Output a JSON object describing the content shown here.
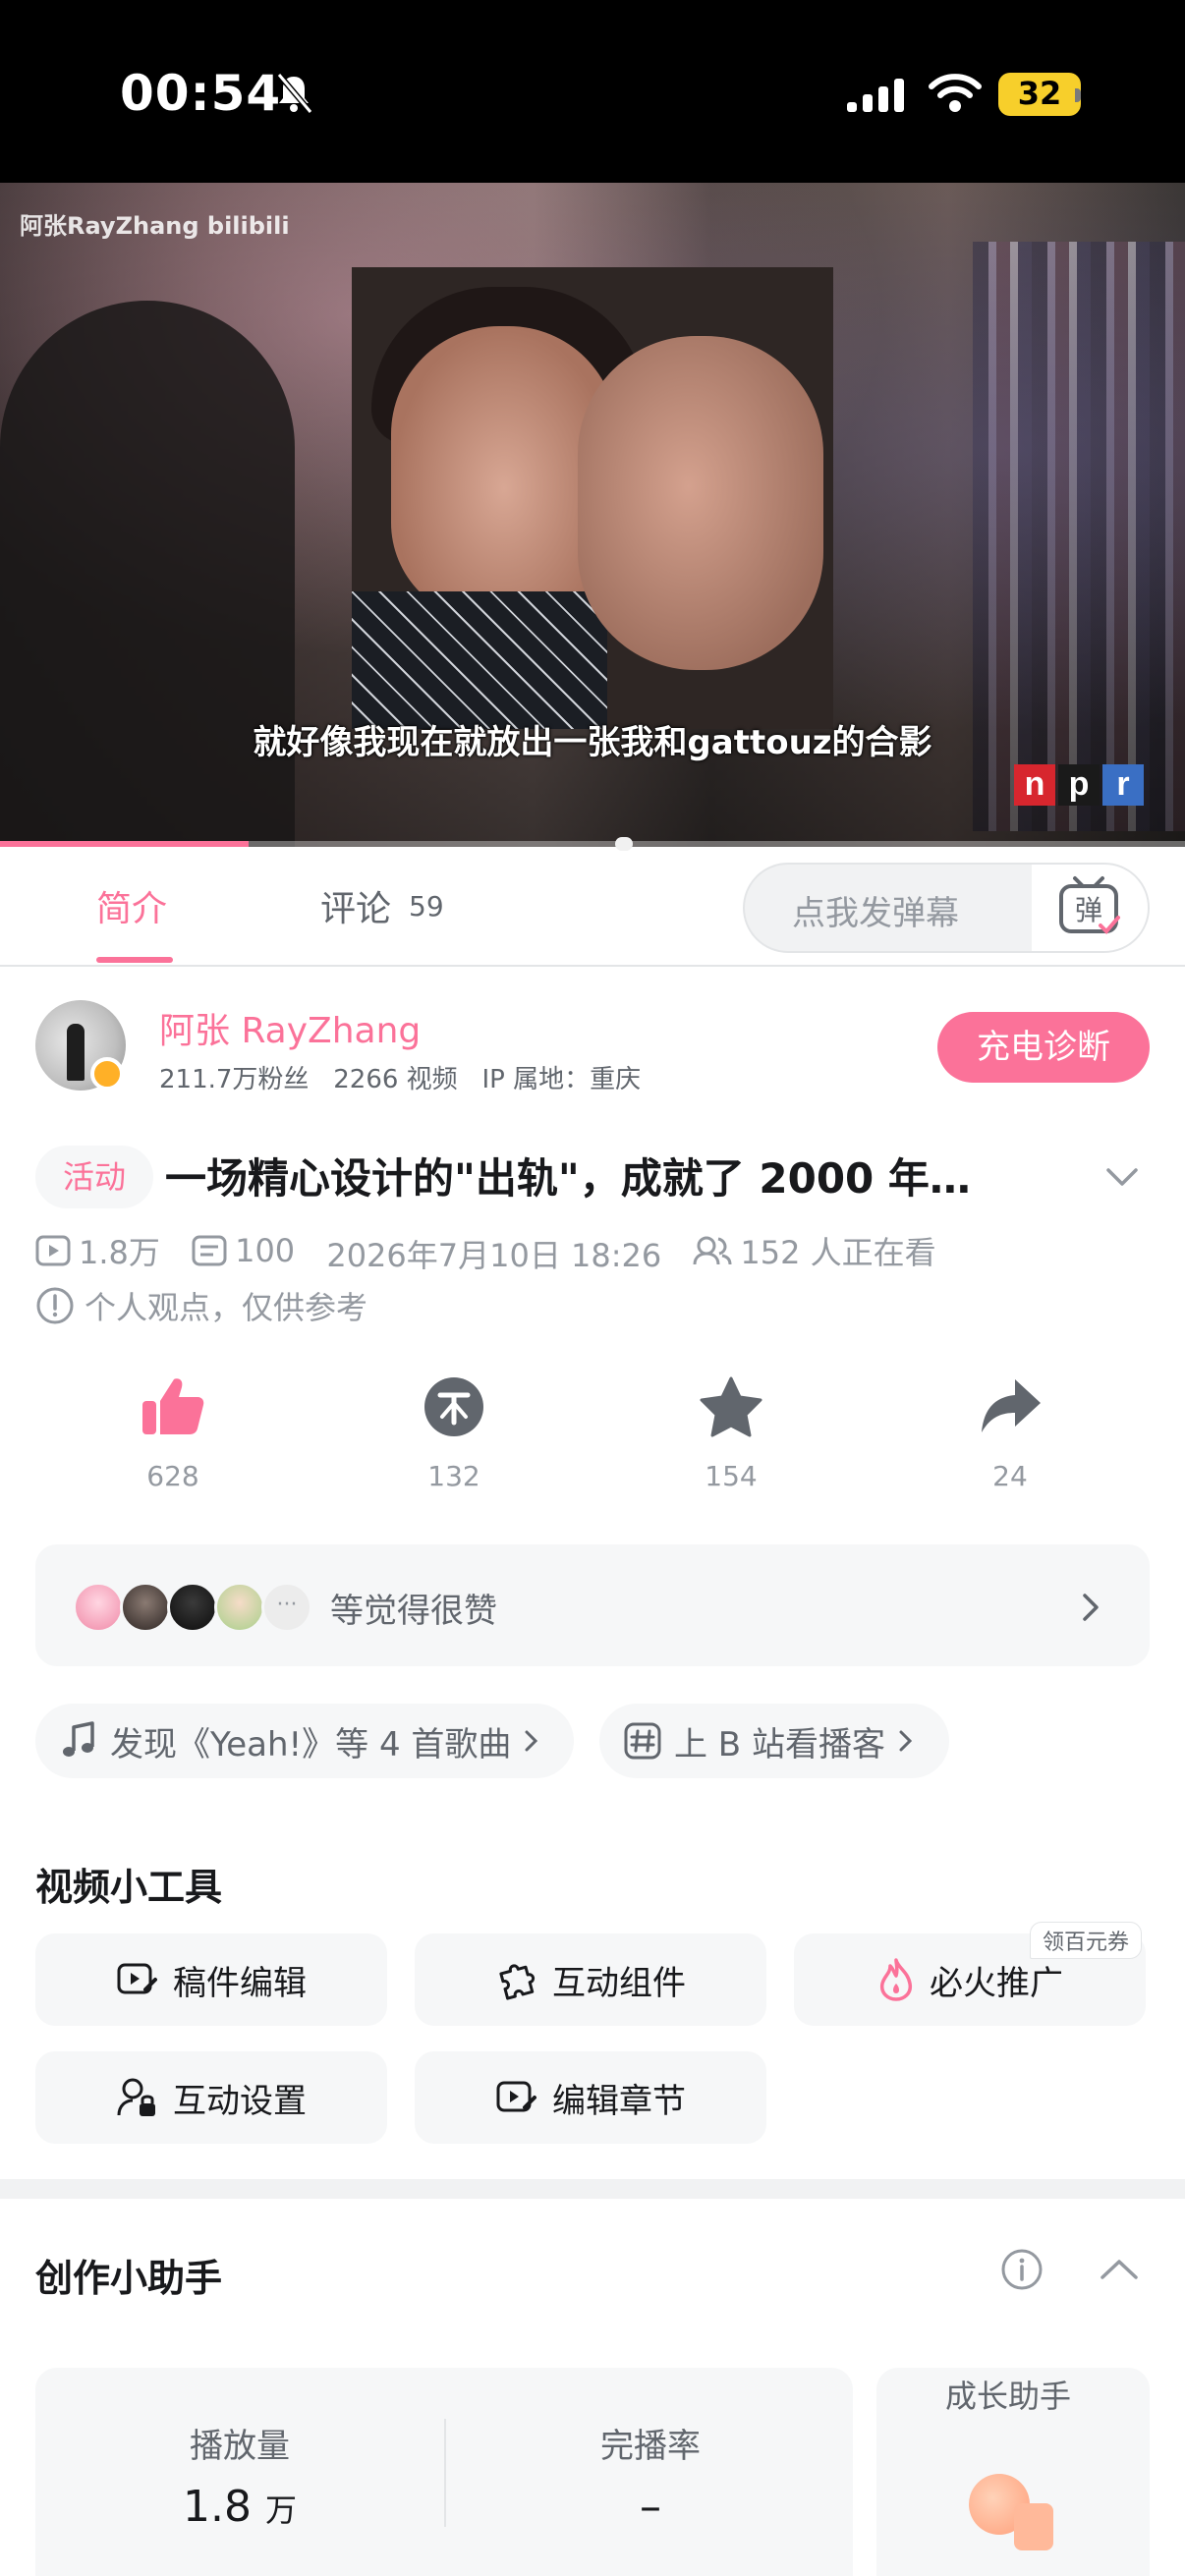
{
  "status_bar": {
    "time": "00:54",
    "battery": "32"
  },
  "video": {
    "watermark": "阿张RayZhang bilibili",
    "subtitle": "就好像我现在就放出一张我和gattouz的合影",
    "npr_logo": [
      "n",
      "p",
      "r"
    ],
    "progress_fraction": 0.21
  },
  "tabs": {
    "intro": "简介",
    "comments": "评论",
    "comments_count": "59"
  },
  "danmaku": {
    "placeholder": "点我发弹幕",
    "button_glyph": "弹"
  },
  "uploader": {
    "name": "阿张 RayZhang",
    "followers": "211.7万粉丝",
    "videos": "2266 视频",
    "ip": "IP 属地：重庆",
    "charge_button": "充电诊断"
  },
  "video_info": {
    "tag": "活动",
    "title": "一场精心设计的\"出轨\"，成就了 2000 年…",
    "views": "1.8万",
    "danmaku_count": "100",
    "publish_time": "2026年7月10日 18:26",
    "watching": "152 人正在看",
    "notice": "个人观点，仅供参考"
  },
  "actions": {
    "like": "628",
    "coin": "132",
    "favorite": "154",
    "share": "24"
  },
  "liked_by": {
    "text": "等觉得很赞",
    "more": "···"
  },
  "pills": {
    "music": "发现《Yeah!》等 4 首歌曲",
    "podcast": "上 B 站看播客"
  },
  "tools": {
    "title": "视频小工具",
    "coupon": "领百元券",
    "items": [
      "稿件编辑",
      "互动组件",
      "必火推广",
      "互动设置",
      "编辑章节"
    ]
  },
  "assistant": {
    "title": "创作小助手",
    "play_label": "播放量",
    "play_value": "1.8",
    "play_unit": "万",
    "completion_label": "完播率",
    "completion_value": "–",
    "growth_title": "成长助手"
  },
  "colors": {
    "accent": "#fb7299",
    "text_secondary": "#9499a0",
    "card_bg": "#f6f7f8"
  }
}
